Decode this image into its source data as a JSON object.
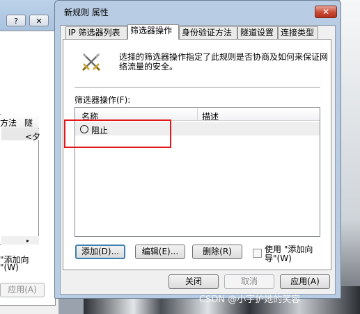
{
  "background_window": {
    "help_label": "?",
    "close_label": "✕",
    "column_1": "方法",
    "column_2": "隧",
    "row_value": "<夕",
    "checkbox_text_1": "\"添加向",
    "checkbox_text_2": "\"(W)",
    "apply_label": "应用(A)"
  },
  "dialog": {
    "title": "新规则 属性",
    "close_label": "✕",
    "tabs": [
      {
        "label": "IP 筛选器列表"
      },
      {
        "label": "筛选器操作"
      },
      {
        "label": "身份验证方法"
      },
      {
        "label": "隧道设置"
      },
      {
        "label": "连接类型"
      }
    ],
    "selected_tab": "筛选器操作",
    "description": "选择的筛选器操作指定了此规则是否协商及如何来保证网络流量的安全。",
    "list_label": "筛选器操作(F):",
    "columns": {
      "name": "名称",
      "description": "描述"
    },
    "rows": [
      {
        "name": "阻止",
        "description": ""
      }
    ],
    "buttons": {
      "add": "添加(D)...",
      "edit": "编辑(E)...",
      "delete": "删除(R)",
      "use_wizard": "使用 \"添加向导\"(W)"
    },
    "footer": {
      "close": "关闭",
      "cancel": "取消",
      "apply": "应用(A)"
    }
  },
  "watermark": "CSDN @小宇护她的笑容",
  "colors": {
    "highlight_box": "#e2161b",
    "title_bar": "#b8cde4",
    "close_button": "#c94934"
  }
}
